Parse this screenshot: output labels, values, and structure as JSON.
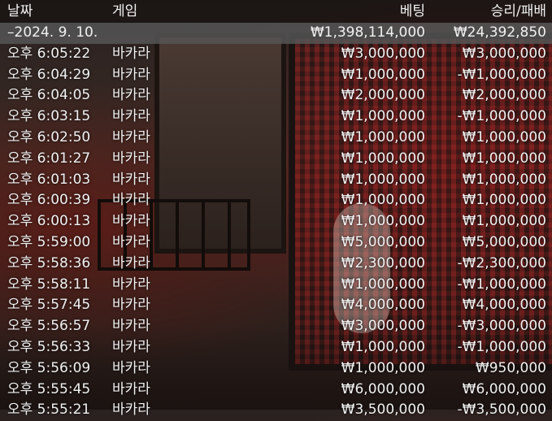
{
  "headers": {
    "date": "날짜",
    "game": "게임",
    "bet": "베팅",
    "result": "승리/패배"
  },
  "summary": {
    "date": "–2024. 9. 10.",
    "bet": "₩1,398,114,000",
    "result": "₩24,392,850"
  },
  "rows": [
    {
      "time": "오후 6:05:22",
      "game": "바카라",
      "bet": "₩3,000,000",
      "result": "₩3,000,000"
    },
    {
      "time": "오후 6:04:29",
      "game": "바카라",
      "bet": "₩1,000,000",
      "result": "-₩1,000,000"
    },
    {
      "time": "오후 6:04:05",
      "game": "바카라",
      "bet": "₩2,000,000",
      "result": "₩2,000,000"
    },
    {
      "time": "오후 6:03:15",
      "game": "바카라",
      "bet": "₩1,000,000",
      "result": "-₩1,000,000"
    },
    {
      "time": "오후 6:02:50",
      "game": "바카라",
      "bet": "₩1,000,000",
      "result": "₩1,000,000"
    },
    {
      "time": "오후 6:01:27",
      "game": "바카라",
      "bet": "₩1,000,000",
      "result": "₩1,000,000"
    },
    {
      "time": "오후 6:01:03",
      "game": "바카라",
      "bet": "₩1,000,000",
      "result": "₩1,000,000"
    },
    {
      "time": "오후 6:00:39",
      "game": "바카라",
      "bet": "₩1,000,000",
      "result": "₩1,000,000"
    },
    {
      "time": "오후 6:00:13",
      "game": "바카라",
      "bet": "₩1,000,000",
      "result": "₩1,000,000"
    },
    {
      "time": "오후 5:59:00",
      "game": "바카라",
      "bet": "₩5,000,000",
      "result": "₩5,000,000"
    },
    {
      "time": "오후 5:58:36",
      "game": "바카라",
      "bet": "₩2,300,000",
      "result": "-₩2,300,000"
    },
    {
      "time": "오후 5:58:11",
      "game": "바카라",
      "bet": "₩1,000,000",
      "result": "-₩1,000,000"
    },
    {
      "time": "오후 5:57:45",
      "game": "바카라",
      "bet": "₩4,000,000",
      "result": "₩4,000,000"
    },
    {
      "time": "오후 5:56:57",
      "game": "바카라",
      "bet": "₩3,000,000",
      "result": "-₩3,000,000"
    },
    {
      "time": "오후 5:56:33",
      "game": "바카라",
      "bet": "₩1,000,000",
      "result": "-₩1,000,000"
    },
    {
      "time": "오후 5:56:09",
      "game": "바카라",
      "bet": "₩1,000,000",
      "result": "₩950,000"
    },
    {
      "time": "오후 5:55:45",
      "game": "바카라",
      "bet": "₩6,000,000",
      "result": "₩6,000,000"
    },
    {
      "time": "오후 5:55:21",
      "game": "바카라",
      "bet": "₩3,500,000",
      "result": "-₩3,500,000"
    }
  ]
}
